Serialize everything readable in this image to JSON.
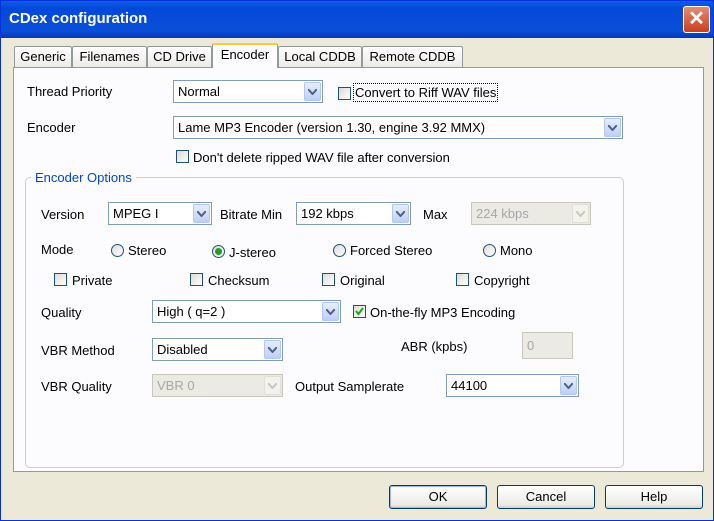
{
  "window": {
    "title": "CDex configuration"
  },
  "tabs": [
    {
      "label": "Generic"
    },
    {
      "label": "Filenames"
    },
    {
      "label": "CD Drive"
    },
    {
      "label": "Encoder"
    },
    {
      "label": "Local CDDB"
    },
    {
      "label": "Remote CDDB"
    }
  ],
  "active_tab": "Encoder",
  "thread_priority": {
    "label": "Thread Priority",
    "value": "Normal"
  },
  "convert_riff": {
    "label": "Convert to Riff WAV files",
    "checked": false
  },
  "encoder": {
    "label": "Encoder",
    "value": "Lame MP3 Encoder (version 1.30, engine 3.92 MMX)"
  },
  "dont_delete": {
    "label": "Don't delete ripped WAV file after conversion",
    "checked": false
  },
  "encoder_options": {
    "title": "Encoder Options",
    "version": {
      "label": "Version",
      "value": "MPEG I"
    },
    "bitrate_min": {
      "label": "Bitrate Min",
      "value": "192 kbps"
    },
    "max": {
      "label": "Max",
      "value": "224 kbps",
      "disabled": true
    },
    "mode": {
      "label": "Mode",
      "options": [
        "Stereo",
        "J-stereo",
        "Forced Stereo",
        "Mono"
      ],
      "selected": "J-stereo"
    },
    "flags": [
      {
        "label": "Private",
        "checked": false
      },
      {
        "label": "Checksum",
        "checked": false
      },
      {
        "label": "Original",
        "checked": false
      },
      {
        "label": "Copyright",
        "checked": false
      }
    ],
    "quality": {
      "label": "Quality",
      "value": "High ( q=2 )"
    },
    "on_the_fly": {
      "label": "On-the-fly MP3 Encoding",
      "checked": true
    },
    "vbr_method": {
      "label": "VBR Method",
      "value": "Disabled"
    },
    "abr": {
      "label": "ABR (kpbs)",
      "value": "0",
      "disabled": true
    },
    "vbr_quality": {
      "label": "VBR Quality",
      "value": "VBR 0",
      "disabled": true
    },
    "output_samplerate": {
      "label": "Output Samplerate",
      "value": "44100"
    }
  },
  "buttons": {
    "ok": "OK",
    "cancel": "Cancel",
    "help": "Help"
  }
}
